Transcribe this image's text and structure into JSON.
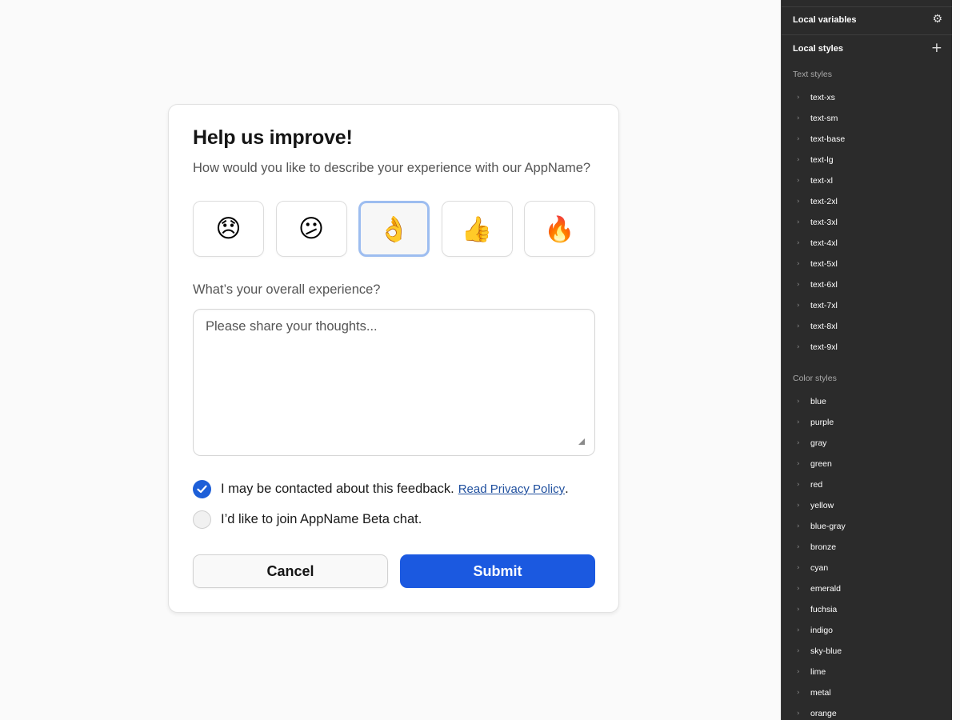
{
  "feedback": {
    "title": "Help us improve!",
    "subtitle": "How would you like to describe your experience with our AppName?",
    "emojis": [
      {
        "glyph": "😞",
        "icon": "disappointed-face-icon"
      },
      {
        "glyph": "😕",
        "icon": "confused-face-icon"
      },
      {
        "glyph": "👌",
        "icon": "ok-hand-icon",
        "selected": true
      },
      {
        "glyph": "👍",
        "icon": "thumbs-up-icon"
      },
      {
        "glyph": "🔥",
        "icon": "fire-icon"
      }
    ],
    "experience_label": "What’s your overall experience?",
    "textarea_placeholder": "Please share your thoughts...",
    "textarea_value": "",
    "contact_checkbox": {
      "label": "I may be contacted about this feedback.",
      "checked": true
    },
    "privacy_link": "Read Privacy Policy",
    "privacy_suffix": ".",
    "beta_checkbox": {
      "label": "I’d like to join AppName Beta chat.",
      "checked": false
    },
    "cancel_label": "Cancel",
    "submit_label": "Submit"
  },
  "panel": {
    "local_variables": "Local variables",
    "local_variables_icon": "adjust-sliders-icon",
    "local_styles": "Local styles",
    "add_style_icon": "plus-icon",
    "text_styles_label": "Text styles",
    "text_styles": [
      "text-xs",
      "text-sm",
      "text-base",
      "text-lg",
      "text-xl",
      "text-2xl",
      "text-3xl",
      "text-4xl",
      "text-5xl",
      "text-6xl",
      "text-7xl",
      "text-8xl",
      "text-9xl"
    ],
    "color_styles_label": "Color styles",
    "color_styles": [
      "blue",
      "purple",
      "gray",
      "green",
      "red",
      "yellow",
      "blue-gray",
      "bronze",
      "cyan",
      "emerald",
      "fuchsia",
      "indigo",
      "sky-blue",
      "lime",
      "metal",
      "orange"
    ]
  },
  "colors": {
    "primary": "#1b59e0",
    "checkbox_on": "#1d5fd8",
    "selected_border": "#9dbdf0",
    "link": "#1f4f9e",
    "panel_bg": "#2b2b2b"
  }
}
